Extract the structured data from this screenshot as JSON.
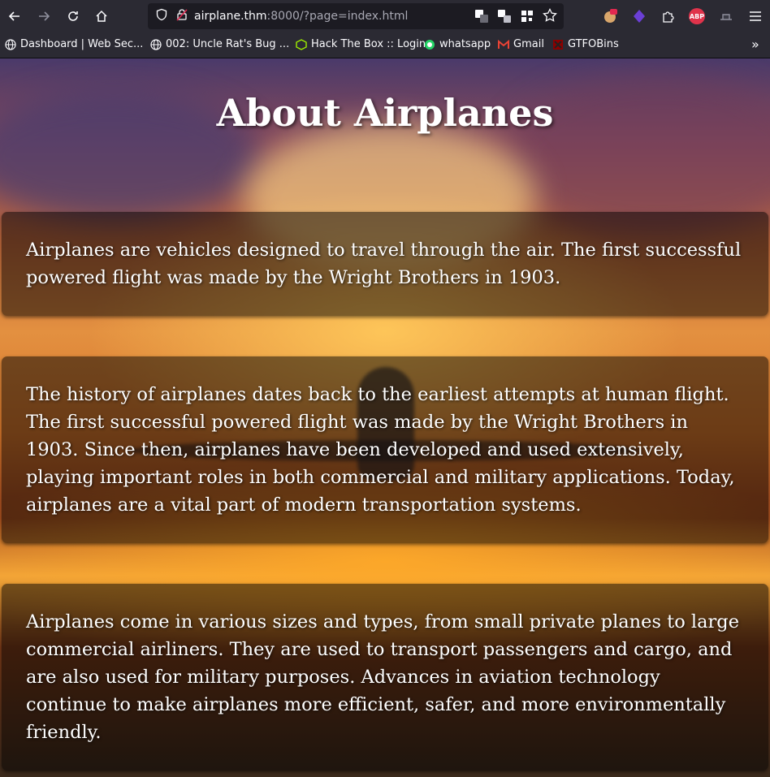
{
  "browser": {
    "url_host": "airplane.thm",
    "url_rest": ":8000/?page=index.html",
    "bookmarks": [
      {
        "label": "Dashboard | Web Sec...",
        "icon": "globe-icon"
      },
      {
        "label": "002: Uncle Rat's Bug ...",
        "icon": "globe-icon"
      },
      {
        "label": "Hack The Box :: Login",
        "icon": "htb-cube-icon"
      },
      {
        "label": "whatsapp",
        "icon": "whatsapp-icon"
      },
      {
        "label": "Gmail",
        "icon": "gmail-icon"
      },
      {
        "label": "GTFOBins",
        "icon": "gtfobins-icon"
      }
    ],
    "extensions": {
      "abp_label": "ABP"
    }
  },
  "page": {
    "title": "About Airplanes",
    "paragraphs": [
      "Airplanes are vehicles designed to travel through the air. The first successful powered flight was made by the Wright Brothers in 1903.",
      "The history of airplanes dates back to the earliest attempts at human flight. The first successful powered flight was made by the Wright Brothers in 1903. Since then, airplanes have been developed and used extensively, playing important roles in both commercial and military applications. Today, airplanes are a vital part of modern transportation systems.",
      "Airplanes come in various sizes and types, from small private planes to large commercial airliners. They are used to transport passengers and cargo, and are also used for military purposes. Advances in aviation technology continue to make airplanes more efficient, safer, and more environmentally friendly."
    ]
  },
  "colors": {
    "toolbar_bg": "#2b2a33",
    "urlbar_bg": "#1c1b22",
    "card_bg": "rgba(0,0,0,0.5)"
  }
}
